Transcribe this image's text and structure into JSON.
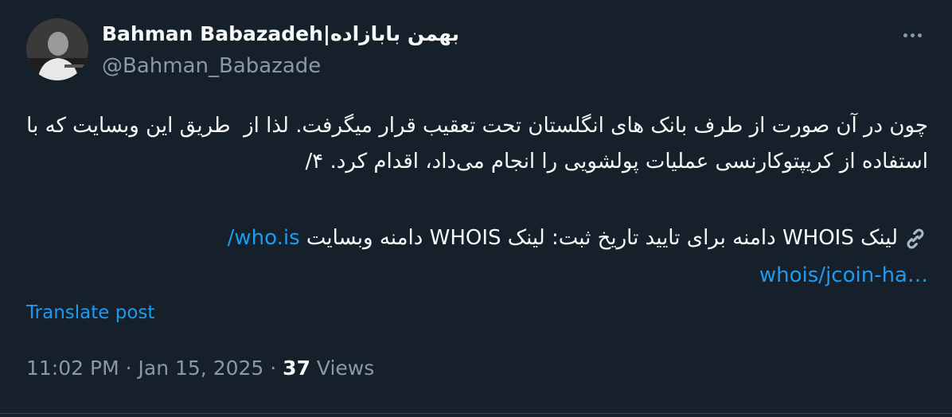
{
  "tweet": {
    "author_name": "Bahman Babazadeh|بهمن بابازاده",
    "handle": "@Bahman_Babazade",
    "body_text": "چون در آن صورت از طرف بانک های انگلستان تحت تعقیب قرار میگرفت. لذا از  طریق این وبسایت که با استفاده از کریپتوکارنسی عملیات پولشویی را انجام می‌داد، اقدام کرد. ۴/",
    "link_label": "لینک WHOIS دامنه برای تایید تاریخ ثبت: لینک  WHOIS دامنه وبسایت ",
    "link_url_part1": "who.is/",
    "link_url_part2": "whois/jcoin-ha…",
    "translate_label": "Translate post",
    "time": "11:02 PM",
    "date": "Jan 15, 2025",
    "views_count": "37",
    "views_label": "Views",
    "separator": "·"
  },
  "icons": {
    "more": "more-horizontal-icon",
    "link": "link-chain-icon"
  },
  "colors": {
    "background": "#15202b",
    "text": "#f7f9f9",
    "secondary": "#8b98a5",
    "link": "#1d9bf0"
  }
}
